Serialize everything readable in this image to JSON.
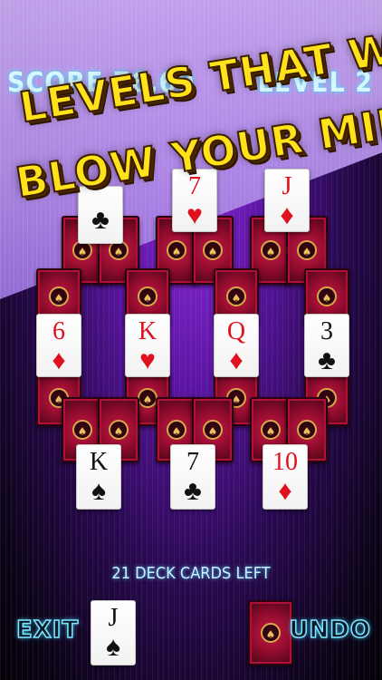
{
  "hud": {
    "score": "SCORE 76,60",
    "level": "LEVEL 2"
  },
  "banner": {
    "line1": "LEVELS THAT WILL",
    "line2": "BLOW YOUR MIND!"
  },
  "cards": {
    "top_clubs": {
      "rank": "",
      "suit": "♣"
    },
    "top_7h": {
      "rank": "7",
      "suit": "♥"
    },
    "top_jd": {
      "rank": "J",
      "suit": "♦"
    },
    "mid_6d": {
      "rank": "6",
      "suit": "♦"
    },
    "mid_kh": {
      "rank": "K",
      "suit": "♥"
    },
    "mid_qd": {
      "rank": "Q",
      "suit": "♦"
    },
    "mid_3c": {
      "rank": "3",
      "suit": "♣"
    },
    "bot_ks": {
      "rank": "K",
      "suit": "♠"
    },
    "bot_7c": {
      "rank": "7",
      "suit": "♣"
    },
    "bot_10d": {
      "rank": "10",
      "suit": "♦"
    },
    "waste_js": {
      "rank": "J",
      "suit": "♠"
    }
  },
  "deck_info": "21 DECK CARDS LEFT",
  "buttons": {
    "exit": "EXIT",
    "undo": "UNDO"
  },
  "colors": {
    "card_red": "#e0111e",
    "card_back": "#8e0b2c",
    "banner_yellow": "#ffe21a",
    "hud_cyan": "#d9f6ff"
  }
}
